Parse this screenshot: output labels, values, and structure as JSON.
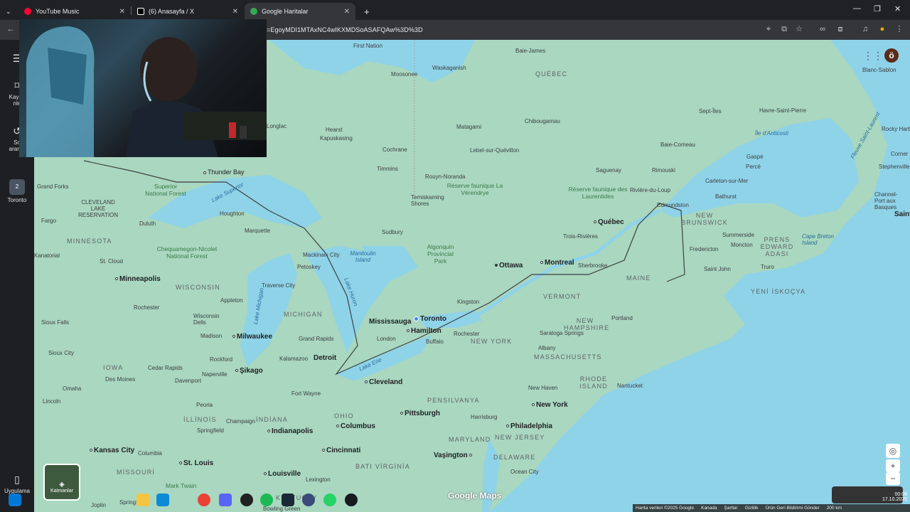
{
  "tabs": [
    {
      "title": "YouTube Music",
      "icon": "youtube-music-icon",
      "color": "#ff0000"
    },
    {
      "title": "(6) Anasayfa / X",
      "icon": "x-icon",
      "color": "#ffffff"
    },
    {
      "title": "Google Haritalar",
      "icon": "google-maps-icon",
      "color": "#34a853"
    }
  ],
  "new_tab": "+",
  "address_bar": {
    "url": "=EgoyMDI1MTAxNC4wIKXMDSoASAFQAw%3D%3D"
  },
  "sidebar": {
    "menu": "☰",
    "saved_label_1": "Kayde",
    "saved_label_2": "nle",
    "recent_label_1": "So",
    "recent_label_2": "arama",
    "place_label": "Toronto",
    "place_badge": "2",
    "apps_label": "Uygulama"
  },
  "profile_initial": "ö",
  "layers_label": "Katmanlar",
  "attribution": [
    "Harita verileri ©2025 Google",
    "Kanada",
    "Şartlar",
    "Gizlilik",
    "Ürün Geri Bildirimi Gönder",
    "200 km"
  ],
  "google_maps_logo": "Google Maps",
  "clock": {
    "time": "00:08",
    "date": "17.10.2025"
  },
  "map_labels": {
    "first_nation": "First Nation",
    "moosonee": "Moosonee",
    "waskaganish": "Waskaganish",
    "baie_james": "Baie-James",
    "quebec_prov": "QUÉBEC",
    "blanc_sablon": "Blanc-Sablon",
    "chibougamau": "Chibougamau",
    "matagami": "Matagami",
    "sept_iles": "Sept-Îles",
    "havre_st_pierre": "Havre-Saint-Pierre",
    "anticosti": "Île d'Anticosti",
    "rocky_harbour": "Rocky Harbour",
    "corner_brook": "Corner Brook",
    "stephenville": "Stephenville",
    "saint_laurent": "Fleuve Saint-Laurent",
    "baie_comeau": "Baie-Comeau",
    "gaspe": "Gaspé",
    "perce": "Percé",
    "channel_port": "Channel-Port aux Basques",
    "saint_m": "Saint M",
    "hearst": "Hearst",
    "kapuskasing": "Kapuskasing",
    "longlac": "Longlac",
    "cochrane": "Cochrane",
    "lebel": "Lebel-sur-Quévillon",
    "timmins": "Timmins",
    "saguenay": "Saguenay",
    "rimouski": "Rimouski",
    "carleton": "Carleton-sur-Mer",
    "bathurst": "Bathurst",
    "thunder_bay": "Thunder Bay",
    "superior_nf": "Superior National Forest",
    "grand_forks": "Grand Forks",
    "rouyn": "Rouyn-Noranda",
    "reserve_verendrye": "Réserve faunique La Vérendrye",
    "reserve_laurentides": "Réserve faunique des Laurentides",
    "riviere_du_loup": "Rivière-du-Loup",
    "edmundston": "Edmundston",
    "temiskaming": "Temiskaming Shores",
    "lake_superior": "Lake Superior",
    "red_lake": "CLEVELAND LAKE RESERVATION",
    "fargo": "Fargo",
    "duluth": "Duluth",
    "houghton": "Houghton",
    "marquette": "Marquette",
    "sudbury": "Sudbury",
    "new_brunswick": "NEW BRUNSWICK",
    "summerside": "Summerside",
    "pei": "PRENS EDWARD ADASI",
    "cape_breton": "Cape Breton Island",
    "quebec_city": "Québec",
    "trois_rivieres": "Trois-Rivières",
    "minnesota": "MINNESOTA",
    "chequamegon": "Chequamegon-Nicolet National Forest",
    "mackinaw": "Mackinaw City",
    "manitoulin": "Manitoulin Island",
    "algonquin": "Algonquin Provincial Park",
    "ottawa": "Ottawa",
    "montreal": "Montreal",
    "sherbrooke": "Sherbrooke",
    "fredericton": "Fredericton",
    "moncton": "Moncton",
    "truro": "Truro",
    "kanatorial": "Kanatorial",
    "st_cloud": "St. Cloud",
    "petoskey": "Petoskey",
    "maine": "MAINE",
    "saint_john": "Saint John",
    "nova_scotia": "YENİ İSKOÇYA",
    "minneapolis": "Minneapolis",
    "wisconsin": "WISCONSIN",
    "traverse_city": "Traverse City",
    "lake_huron": "Lake Huron",
    "kingston": "Kingston",
    "vermont": "VERMONT",
    "rochester_mn": "Rochester",
    "appleton": "Appleton",
    "lake_michigan": "Lake Michigan",
    "michigan": "MICHIGAN",
    "mississauga": "Mississauga",
    "toronto": "Toronto",
    "hamilton": "Hamilton",
    "rochester_ny": "Rochester",
    "new_hampshire": "NEW HAMPSHIRE",
    "portland": "Portland",
    "sioux_falls": "Sioux Falls",
    "wisconsin_dells": "Wisconsin Dells",
    "madison": "Madison",
    "milwaukee": "Milwaukee",
    "grand_rapids": "Grand Rapids",
    "london": "London",
    "buffalo": "Buffalo",
    "new_york_state": "NEW YORK",
    "saratoga": "Saratoga Springs",
    "albany": "Albany",
    "rockford": "Rockford",
    "kalamazoo": "Kalamazoo",
    "detroit": "Detroit",
    "massachusetts": "MASSACHUSETTS",
    "sioux_city": "Sioux City",
    "iowa": "IOWA",
    "cedar_rapids": "Cedar Rapids",
    "chicago": "Şikago",
    "lake_erie": "Lake Erie",
    "des_moines": "Des Moines",
    "davenport": "Davenport",
    "naperville": "Naperville",
    "cleveland": "Cleveland",
    "rhode_island": "RHODE ISLAND",
    "nantucket": "Nantucket",
    "new_haven": "New Haven",
    "omaha": "Omaha",
    "fort_wayne": "Fort Wayne",
    "pennsylvania": "PENSILVANYA",
    "new_york_city": "New York",
    "lincoln": "Lincoln",
    "peoria": "Peoria",
    "ohio": "OHIO",
    "pittsburgh": "Pittsburgh",
    "harrisburg": "Harrisburg",
    "illinois": "İLLİNOİS",
    "champaign": "Champaign",
    "indiana": "İNDİANA",
    "columbus": "Columbus",
    "philadelphia": "Philadelphia",
    "springfield": "Springfield",
    "indianapolis": "Indianapolis",
    "new_jersey": "NEW JERSEY",
    "maryland": "MARYLAND",
    "kansas_city": "Kansas City",
    "columbia": "Columbia",
    "cincinnati": "Cincinnati",
    "washington": "Vaşington",
    "delaware": "DELAWARE",
    "st_louis": "St. Louis",
    "missouri": "MİSSOURİ",
    "louisville": "Louisville",
    "west_virginia": "BATI VİRGİNİA",
    "ocean_city": "Ocean City",
    "lexington": "Lexington",
    "mark_twain": "Mark Twain",
    "joplin": "Joplin",
    "springfield_mo": "Springfield",
    "kentucky": "KENTUCKY",
    "bowling_green": "Bowling Green"
  }
}
